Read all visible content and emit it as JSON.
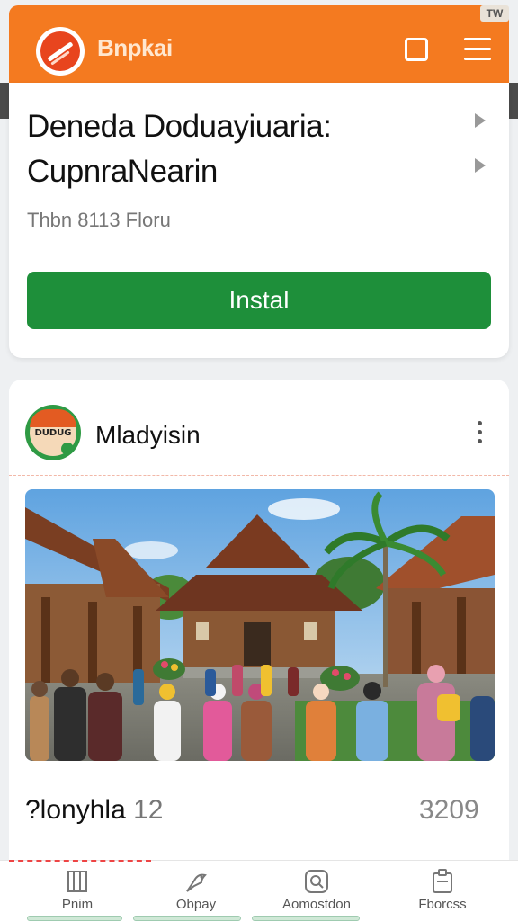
{
  "header": {
    "brand": "Bnpkai",
    "status_badge": "TW",
    "logo_icon": "brand-logo-icon",
    "square_icon": "square-icon",
    "menu_icon": "hamburger-menu-icon",
    "accent_color": "#f47a20"
  },
  "app": {
    "title_line1": "Deneda Doduayiuaria:",
    "title_line2": "CupnraNearin",
    "subtitle": "Thbn 8113 Floru",
    "install_label": "Instal",
    "install_color": "#1e8f3a"
  },
  "post": {
    "author": "Mladyisin",
    "avatar_text": "DUDUG",
    "meta_label": "?lonyhla",
    "meta_number": "12",
    "count": "3209"
  },
  "nav": {
    "items": [
      {
        "label": "Pnim",
        "icon": "home-icon"
      },
      {
        "label": "Obpay",
        "icon": "bird-icon"
      },
      {
        "label": "Aomostdon",
        "icon": "search-icon"
      },
      {
        "label": "Fborcss",
        "icon": "clipboard-icon"
      }
    ]
  }
}
